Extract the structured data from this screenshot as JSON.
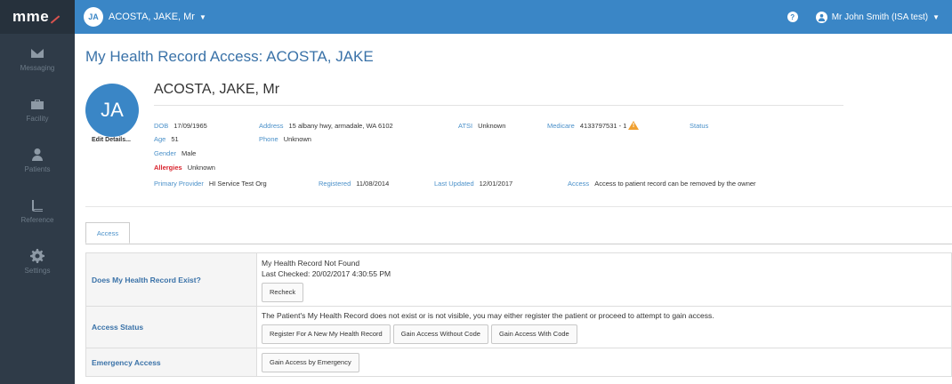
{
  "app": {
    "logo": "mme"
  },
  "sidebar": {
    "items": [
      {
        "label": "Messaging",
        "icon": "envelope-icon"
      },
      {
        "label": "Facility",
        "icon": "briefcase-icon"
      },
      {
        "label": "Patients",
        "icon": "person-icon"
      },
      {
        "label": "Reference",
        "icon": "book-icon"
      },
      {
        "label": "Settings",
        "icon": "gear-icon"
      }
    ]
  },
  "topbar": {
    "patient_initials": "JA",
    "patient_name": "ACOSTA, JAKE, Mr",
    "help": "?",
    "user_name": "Mr John Smith (ISA test)"
  },
  "page": {
    "title": "My Health Record Access: ACOSTA, JAKE"
  },
  "patient": {
    "initials": "JA",
    "edit_details": "Edit Details...",
    "full_name": "ACOSTA, JAKE, Mr",
    "dob_label": "DOB",
    "dob": "17/09/1965",
    "age_label": "Age",
    "age": "51",
    "gender_label": "Gender",
    "gender": "Male",
    "allergies_label": "Allergies",
    "allergies": "Unknown",
    "address_label": "Address",
    "address": "15 albany hwy, armadale, WA 6102",
    "phone_label": "Phone",
    "phone": "Unknown",
    "atsi_label": "ATSI",
    "atsi": "Unknown",
    "medicare_label": "Medicare",
    "medicare": "4133797531 - 1",
    "status_label": "Status",
    "primary_provider_label": "Primary Provider",
    "primary_provider": "HI Service Test Org",
    "registered_label": "Registered",
    "registered": "11/08/2014",
    "last_updated_label": "Last Updated",
    "last_updated": "12/01/2017",
    "access_label": "Access",
    "access": "Access to patient record can be removed by the owner"
  },
  "tabs": [
    {
      "label": "Access"
    }
  ],
  "access_table": {
    "exist": {
      "heading": "Does My Health Record Exist?",
      "line1": "My Health Record Not Found",
      "line2": "Last Checked: 20/02/2017 4:30:55 PM",
      "recheck_button": "Recheck"
    },
    "status": {
      "heading": "Access Status",
      "message": "The Patient's My Health Record does not exist or is not visible, you may either register the patient or proceed to attempt to gain access.",
      "register_button": "Register For A New My Health Record",
      "without_code_button": "Gain Access Without Code",
      "with_code_button": "Gain Access With Code"
    },
    "emergency": {
      "heading": "Emergency Access",
      "emergency_button": "Gain Access by Emergency"
    }
  }
}
